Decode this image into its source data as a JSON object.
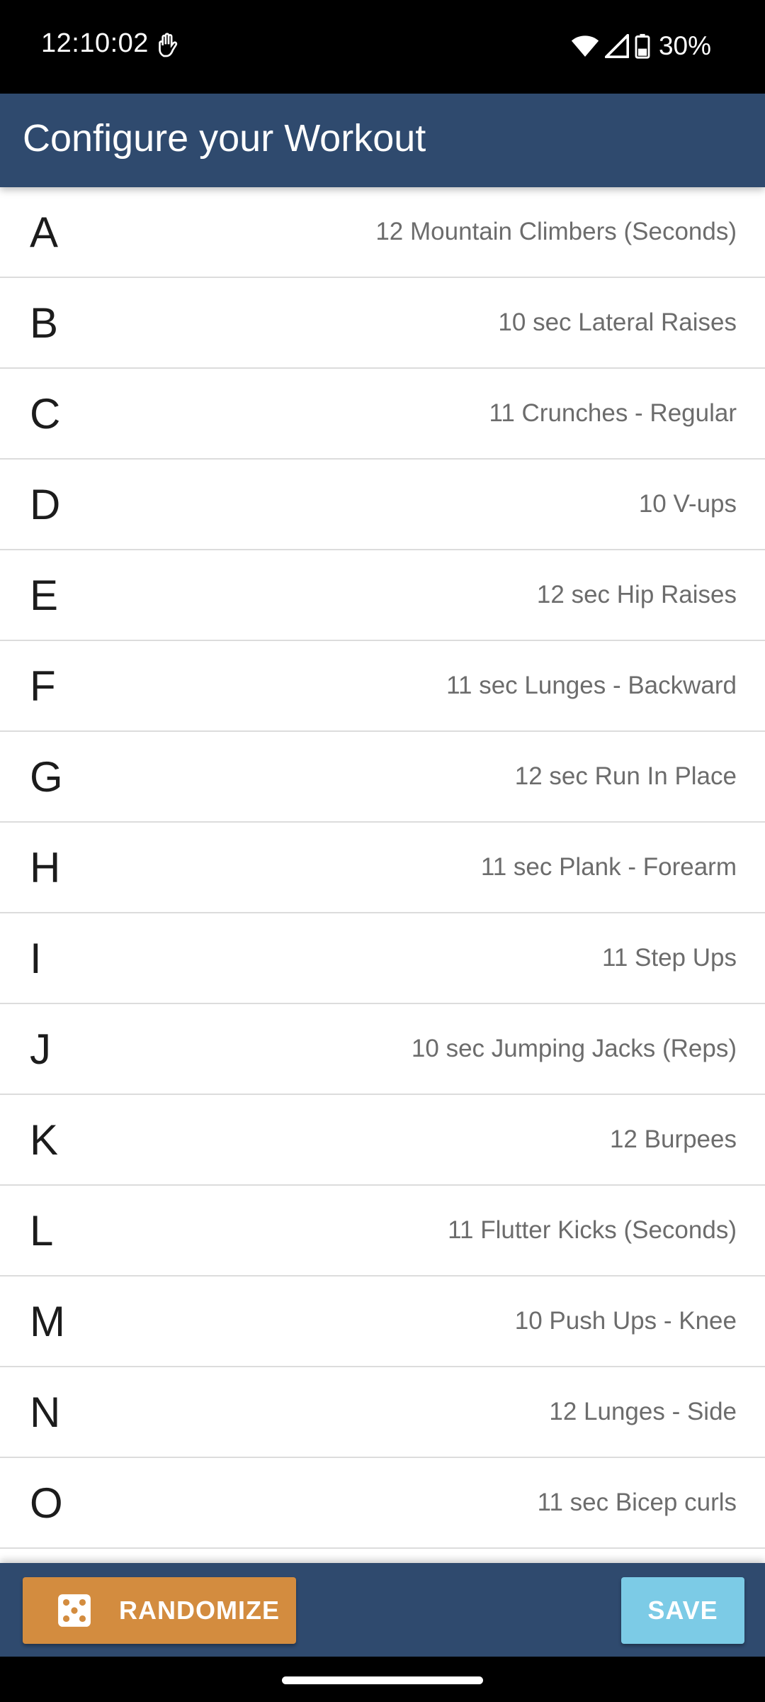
{
  "status_bar": {
    "time": "12:10:02",
    "battery": "30%",
    "icons": [
      "hand-gesture-icon",
      "wifi-icon",
      "cell-signal-icon",
      "battery-icon"
    ]
  },
  "app_bar": {
    "title": "Configure your Workout"
  },
  "workout": {
    "rows": [
      {
        "letter": "A",
        "exercise": "12 Mountain Climbers (Seconds)"
      },
      {
        "letter": "B",
        "exercise": "10 sec Lateral Raises"
      },
      {
        "letter": "C",
        "exercise": "11 Crunches - Regular"
      },
      {
        "letter": "D",
        "exercise": "10 V-ups"
      },
      {
        "letter": "E",
        "exercise": "12 sec Hip Raises"
      },
      {
        "letter": "F",
        "exercise": "11 sec Lunges - Backward"
      },
      {
        "letter": "G",
        "exercise": "12 sec Run In Place"
      },
      {
        "letter": "H",
        "exercise": "11 sec Plank - Forearm"
      },
      {
        "letter": "I",
        "exercise": "11 Step Ups"
      },
      {
        "letter": "J",
        "exercise": "10 sec Jumping Jacks (Reps)"
      },
      {
        "letter": "K",
        "exercise": "12 Burpees"
      },
      {
        "letter": "L",
        "exercise": "11 Flutter Kicks (Seconds)"
      },
      {
        "letter": "M",
        "exercise": "10 Push Ups - Knee"
      },
      {
        "letter": "N",
        "exercise": "12 Lunges - Side"
      },
      {
        "letter": "O",
        "exercise": "11 sec Bicep curls"
      }
    ]
  },
  "bottom_bar": {
    "randomize_label": "RANDOMIZE",
    "randomize_icon": "dice-icon",
    "save_label": "SAVE"
  },
  "colors": {
    "primary": "#2f4a6e",
    "randomize": "#d38c3f",
    "save": "#7ccbe6"
  }
}
